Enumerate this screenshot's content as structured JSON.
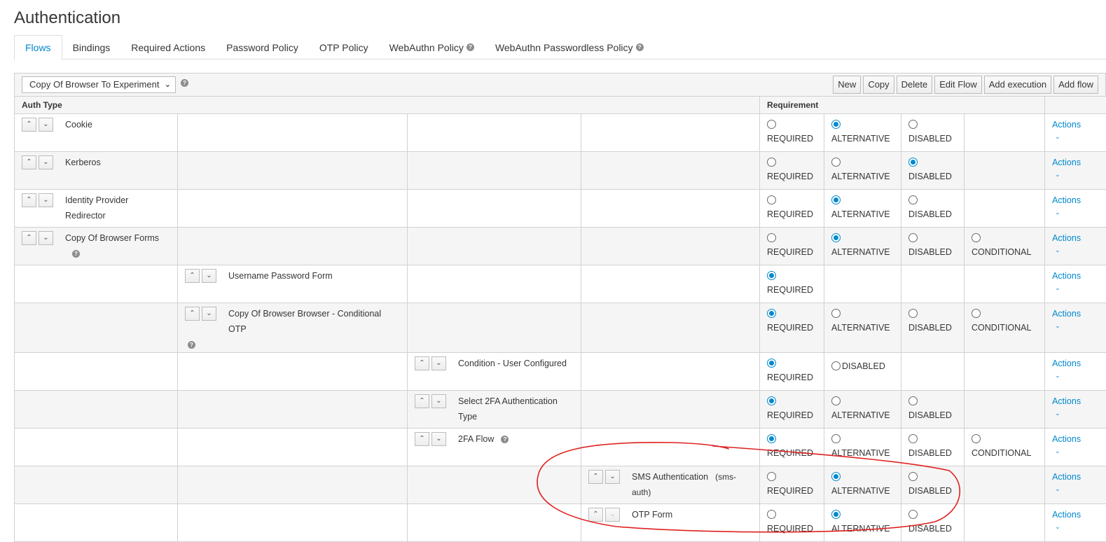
{
  "page": {
    "title": "Authentication"
  },
  "tabs": [
    {
      "label": "Flows",
      "active": true,
      "help": false
    },
    {
      "label": "Bindings",
      "active": false,
      "help": false
    },
    {
      "label": "Required Actions",
      "active": false,
      "help": false
    },
    {
      "label": "Password Policy",
      "active": false,
      "help": false
    },
    {
      "label": "OTP Policy",
      "active": false,
      "help": false
    },
    {
      "label": "WebAuthn Policy",
      "active": false,
      "help": true
    },
    {
      "label": "WebAuthn Passwordless Policy",
      "active": false,
      "help": true
    }
  ],
  "toolbar": {
    "selected_flow": "Copy Of Browser To Experiment",
    "buttons": [
      "New",
      "Copy",
      "Delete",
      "Edit Flow",
      "Add execution",
      "Add flow"
    ]
  },
  "table": {
    "headers": {
      "auth_type": "Auth Type",
      "requirement": "Requirement"
    },
    "actions_label": "Actions",
    "rows": [
      {
        "level": 0,
        "name": "Cookie",
        "alias": "",
        "help": false,
        "stacked": false,
        "options": [
          [
            "REQUIRED",
            false
          ],
          [
            "ALTERNATIVE",
            true
          ],
          [
            "DISABLED",
            false
          ]
        ]
      },
      {
        "level": 0,
        "name": "Kerberos",
        "alias": "",
        "help": false,
        "stacked": false,
        "options": [
          [
            "REQUIRED",
            false
          ],
          [
            "ALTERNATIVE",
            false
          ],
          [
            "DISABLED",
            true
          ]
        ]
      },
      {
        "level": 0,
        "name": "Identity Provider Redirector",
        "alias": "",
        "help": false,
        "stacked": false,
        "options": [
          [
            "REQUIRED",
            false
          ],
          [
            "ALTERNATIVE",
            true
          ],
          [
            "DISABLED",
            false
          ]
        ]
      },
      {
        "level": 0,
        "name": "Copy Of Browser Forms",
        "alias": "",
        "help": true,
        "stacked": false,
        "options": [
          [
            "REQUIRED",
            false
          ],
          [
            "ALTERNATIVE",
            true
          ],
          [
            "DISABLED",
            false
          ],
          [
            "CONDITIONAL",
            false
          ]
        ]
      },
      {
        "level": 1,
        "name": "Username Password Form",
        "alias": "",
        "help": false,
        "stacked": false,
        "options": [
          [
            "REQUIRED",
            true
          ]
        ]
      },
      {
        "level": 1,
        "name": "Copy Of Browser Browser - Conditional OTP",
        "alias": "",
        "help": true,
        "stacked": true,
        "options": [
          [
            "REQUIRED",
            true
          ],
          [
            "ALTERNATIVE",
            false
          ],
          [
            "DISABLED",
            false
          ],
          [
            "CONDITIONAL",
            false
          ]
        ]
      },
      {
        "level": 2,
        "name": "Condition - User Configured",
        "alias": "",
        "help": false,
        "stacked": false,
        "inline_second": true,
        "options": [
          [
            "REQUIRED",
            true
          ],
          [
            "DISABLED",
            false
          ]
        ]
      },
      {
        "level": 2,
        "name": "Select 2FA Authentication Type",
        "alias": "",
        "help": false,
        "stacked": false,
        "options": [
          [
            "REQUIRED",
            true
          ],
          [
            "ALTERNATIVE",
            false
          ],
          [
            "DISABLED",
            false
          ]
        ]
      },
      {
        "level": 2,
        "name": "2FA Flow",
        "alias": "",
        "help": true,
        "stacked": false,
        "options": [
          [
            "REQUIRED",
            true
          ],
          [
            "ALTERNATIVE",
            false
          ],
          [
            "DISABLED",
            false
          ],
          [
            "CONDITIONAL",
            false
          ]
        ]
      },
      {
        "level": 3,
        "name": "SMS Authentication",
        "alias": "(sms-auth)",
        "help": false,
        "stacked": false,
        "options": [
          [
            "REQUIRED",
            false
          ],
          [
            "ALTERNATIVE",
            true
          ],
          [
            "DISABLED",
            false
          ]
        ]
      },
      {
        "level": 3,
        "name": "OTP Form",
        "alias": "",
        "help": false,
        "stacked": false,
        "down_disabled": true,
        "options": [
          [
            "REQUIRED",
            false
          ],
          [
            "ALTERNATIVE",
            true
          ],
          [
            "DISABLED",
            false
          ]
        ]
      }
    ]
  },
  "colors": {
    "accent": "#0088ce",
    "annotation": "#e02020",
    "row_alt": "#f5f5f5",
    "border": "#d1d1d1"
  },
  "icons": {
    "up": "chevron-up-icon",
    "down": "chevron-down-icon",
    "help": "question-circle-icon"
  }
}
